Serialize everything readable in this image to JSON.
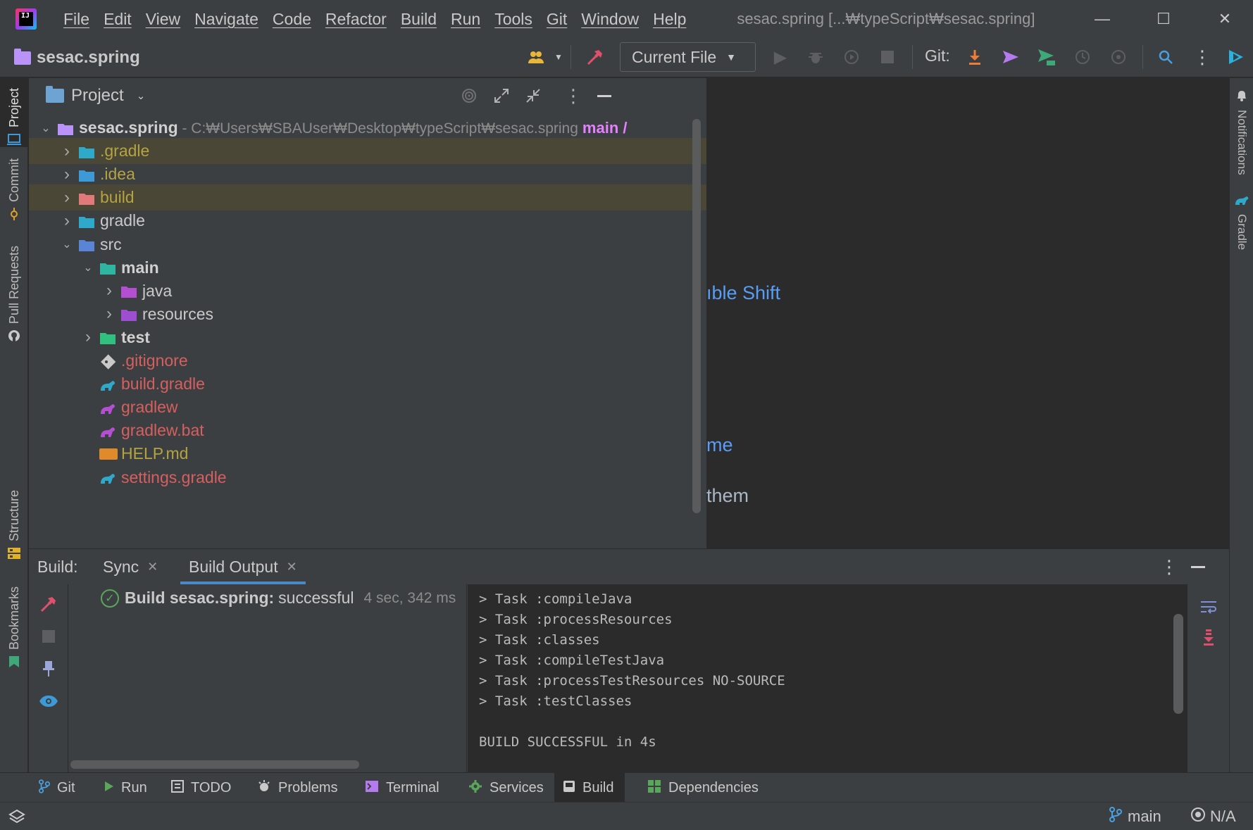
{
  "app": {
    "logo_text": "IJ",
    "menu": [
      "File",
      "Edit",
      "View",
      "Navigate",
      "Code",
      "Refactor",
      "Build",
      "Run",
      "Tools",
      "Git",
      "Window",
      "Help"
    ],
    "window_title": "sesac.spring [...₩typeScript₩sesac.spring]",
    "controls": {
      "minimize": "—",
      "maximize": "☐",
      "close": "✕"
    }
  },
  "toolbar": {
    "project_name": "sesac.spring",
    "run_config": "Current File",
    "git_label": "Git:",
    "colors": {
      "build_hammer": "#e0506d",
      "git_update": "#f07c3a",
      "git_commit": "#b57bee",
      "git_push": "#3ea878",
      "search": "#4a9fe0"
    }
  },
  "left_stripe": {
    "tabs": [
      {
        "label": "Project",
        "active": true,
        "icon": "project-icon"
      },
      {
        "label": "Commit",
        "active": false,
        "icon": "commit-icon"
      },
      {
        "label": "Pull Requests",
        "active": false,
        "icon": "github-icon"
      },
      {
        "label": "Structure",
        "active": false,
        "icon": "structure-icon"
      },
      {
        "label": "Bookmarks",
        "active": false,
        "icon": "bookmark-icon"
      }
    ]
  },
  "right_stripe": {
    "tabs": [
      {
        "label": "Notifications",
        "icon": "bell-icon"
      },
      {
        "label": "Gradle",
        "icon": "gradle-icon"
      }
    ]
  },
  "project_panel": {
    "title": "Project",
    "tree": [
      {
        "name": "sesac.spring",
        "depth": 0,
        "expanded": true,
        "color": "#d0d0d0",
        "bold": true,
        "icon": "module-folder-icon",
        "path": " - C:₩Users₩SBAUser₩Desktop₩typeScript₩sesac.spring",
        "branch": "main / ",
        "hl": false
      },
      {
        "name": ".gradle",
        "depth": 1,
        "expanded": false,
        "color": "#b5a340",
        "icon": "gradle-folder-icon",
        "hl": true
      },
      {
        "name": ".idea",
        "depth": 1,
        "expanded": false,
        "color": "#b5a340",
        "icon": "idea-folder-icon",
        "hl": false
      },
      {
        "name": "build",
        "depth": 1,
        "expanded": false,
        "color": "#b5a340",
        "icon": "excluded-folder-icon",
        "hl": true
      },
      {
        "name": "gradle",
        "depth": 1,
        "expanded": false,
        "color": "#c9c9c9",
        "icon": "gradle-folder-icon",
        "hl": false
      },
      {
        "name": "src",
        "depth": 1,
        "expanded": true,
        "color": "#c9c9c9",
        "icon": "source-folder-icon",
        "hl": false
      },
      {
        "name": "main",
        "depth": 2,
        "expanded": true,
        "color": "#d0d0d0",
        "bold": true,
        "icon": "main-module-folder-icon",
        "hl": false
      },
      {
        "name": "java",
        "depth": 3,
        "expanded": false,
        "color": "#c9c9c9",
        "icon": "java-source-folder-icon",
        "hl": false
      },
      {
        "name": "resources",
        "depth": 3,
        "expanded": false,
        "color": "#c9c9c9",
        "icon": "resources-folder-icon",
        "hl": false
      },
      {
        "name": "test",
        "depth": 2,
        "expanded": false,
        "color": "#d0d0d0",
        "bold": true,
        "icon": "test-folder-icon",
        "hl": false
      },
      {
        "name": ".gitignore",
        "depth": 2,
        "leaf": true,
        "color": "#d65f5f",
        "icon": "gitignore-file-icon",
        "hl": false
      },
      {
        "name": "build.gradle",
        "depth": 2,
        "leaf": true,
        "color": "#d65f5f",
        "icon": "gradle-file-icon",
        "hl": false
      },
      {
        "name": "gradlew",
        "depth": 2,
        "leaf": true,
        "color": "#d65f5f",
        "icon": "gradlew-file-icon",
        "hl": false
      },
      {
        "name": "gradlew.bat",
        "depth": 2,
        "leaf": true,
        "color": "#d65f5f",
        "icon": "gradlew-file-icon",
        "hl": false
      },
      {
        "name": "HELP.md",
        "depth": 2,
        "leaf": true,
        "color": "#b5a340",
        "icon": "markdown-file-icon",
        "hl": false
      },
      {
        "name": "settings.gradle",
        "depth": 2,
        "leaf": true,
        "color": "#d65f5f",
        "icon": "gradle-file-icon",
        "hl": false
      }
    ]
  },
  "editor": {
    "hints": [
      {
        "text": "ıble Shift",
        "color": "#589df6"
      },
      {
        "text": "me",
        "color": "#589df6"
      },
      {
        "text": "them",
        "color": "#a9b7c6"
      }
    ]
  },
  "build": {
    "label": "Build:",
    "tabs": [
      {
        "label": "Sync",
        "active": false
      },
      {
        "label": "Build Output",
        "active": true
      }
    ],
    "status": {
      "name": "Build sesac.spring:",
      "result": "successful",
      "time": "4 sec, 342 ms"
    },
    "output": [
      "> Task :compileJava",
      "> Task :processResources",
      "> Task :classes",
      "> Task :compileTestJava",
      "> Task :processTestResources NO-SOURCE",
      "> Task :testClasses",
      "",
      "BUILD SUCCESSFUL in 4s"
    ]
  },
  "bottom_tabs": [
    {
      "label": "Git",
      "icon": "git-branch-icon",
      "active": false
    },
    {
      "label": "Run",
      "icon": "run-icon",
      "active": false
    },
    {
      "label": "TODO",
      "icon": "todo-icon",
      "active": false
    },
    {
      "label": "Problems",
      "icon": "problems-icon",
      "active": false
    },
    {
      "label": "Terminal",
      "icon": "terminal-icon",
      "active": false
    },
    {
      "label": "Services",
      "icon": "services-icon",
      "active": false
    },
    {
      "label": "Build",
      "icon": "build-icon",
      "active": true
    },
    {
      "label": "Dependencies",
      "icon": "dependencies-icon",
      "active": false
    }
  ],
  "statusbar": {
    "branch": "main",
    "readonly": "N/A"
  }
}
